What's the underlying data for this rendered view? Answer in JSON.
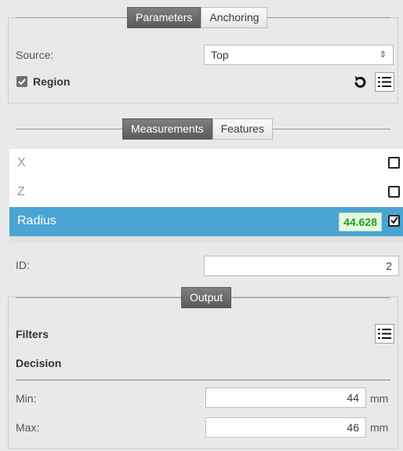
{
  "parameters_section": {
    "tabs": [
      "Parameters",
      "Anchoring"
    ],
    "source_label": "Source:",
    "source_value": "Top",
    "region_label": "Region",
    "region_checked": true
  },
  "measurements_section": {
    "tabs": [
      "Measurements",
      "Features"
    ],
    "rows": [
      {
        "name": "X",
        "checked": false,
        "value": ""
      },
      {
        "name": "Z",
        "checked": false,
        "value": ""
      },
      {
        "name": "Radius",
        "checked": true,
        "value": "44.628"
      }
    ]
  },
  "id_row": {
    "label": "ID:",
    "value": "2"
  },
  "output_section": {
    "title": "Output",
    "filters_label": "Filters",
    "decision_label": "Decision",
    "min_label": "Min:",
    "min_value": "44",
    "max_label": "Max:",
    "max_value": "46",
    "unit": "mm"
  },
  "colors": {
    "selected_row": "#4aa4d4",
    "value_green": "#1aa12a"
  }
}
